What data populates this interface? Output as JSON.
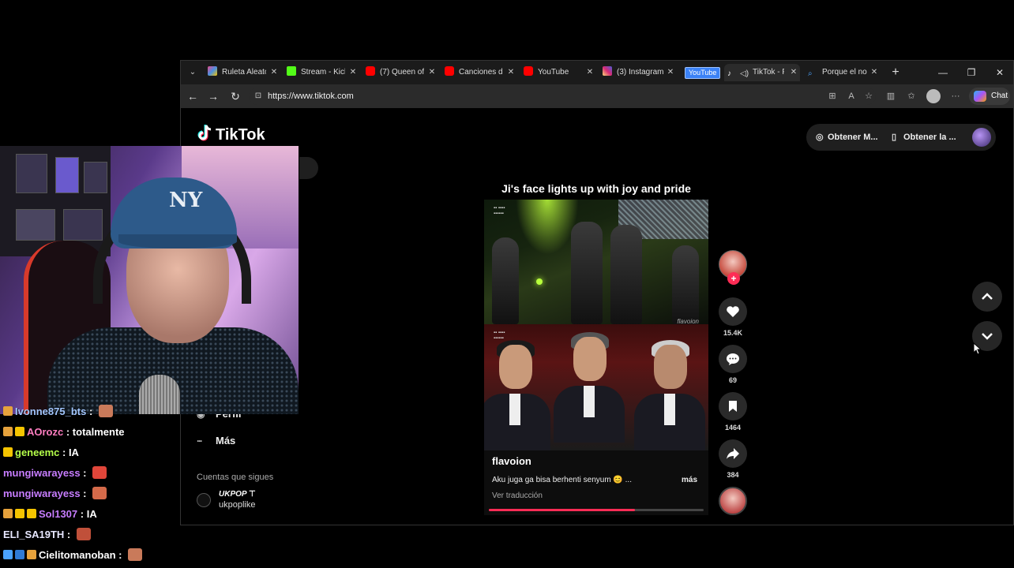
{
  "browser": {
    "tabs": [
      {
        "label": "Ruleta Aleatoria",
        "favicon_color": "#e94b8a"
      },
      {
        "label": "Stream - Kick",
        "favicon_color": "#53fc18"
      },
      {
        "label": "(7) Queen of",
        "favicon_color": "#ff0000"
      },
      {
        "label": "Canciones de",
        "favicon_color": "#ff0000"
      },
      {
        "label": "YouTube",
        "favicon_color": "#ff0000"
      },
      {
        "label": "(3) Instagram",
        "favicon_color": "#d62976"
      },
      {
        "label": "TikTok - F",
        "favicon_color": "#ffffff"
      },
      {
        "label": "Porque el no",
        "favicon_color": "#4aa3ff"
      }
    ],
    "youtube_badge": "YouTube",
    "url": "https://www.tiktok.com",
    "chat_label": "Chat"
  },
  "tiktok": {
    "logo": "TikTok",
    "top_buttons": [
      "Obtener M...",
      "Obtener la ..."
    ],
    "nav": [
      {
        "label": "Perfil",
        "icon": "user-icon"
      },
      {
        "label": "Más",
        "icon": "more-icon"
      }
    ],
    "following_title": "Cuentas que sigues",
    "following": [
      {
        "name": "UKPOP",
        "username": "ukpoplike"
      }
    ],
    "video": {
      "caption_overlay": "Ji's face lights up with joy and pride",
      "author": "flavoion",
      "description": "Aku juga ga bisa berhenti senyum 😊 ...",
      "more": "más",
      "translate": "Ver traducción",
      "watermark": "flavoion",
      "progress": 0.68
    },
    "actions": {
      "likes": "15.4K",
      "comments": "69",
      "saves": "1464",
      "shares": "384"
    }
  },
  "chat": [
    {
      "user": "Ivonne875_bts",
      "color": "#a3c7ff",
      "msg": "",
      "emote": "#c97a5a",
      "badges": [
        "#e6a23c"
      ]
    },
    {
      "user": "AOrozc",
      "color": "#ff7ec1",
      "msg": "totalmente",
      "emote": "",
      "badges": [
        "#e6a23c",
        "#f5c400"
      ]
    },
    {
      "user": "geneemc",
      "color": "#b5ff4a",
      "msg": "IA",
      "emote": "",
      "badges": [
        "#f5c400"
      ]
    },
    {
      "user": "mungiwarayess",
      "color": "#c77dff",
      "msg": "",
      "emote": "#e0463a",
      "badges": []
    },
    {
      "user": "mungiwarayess",
      "color": "#c77dff",
      "msg": "",
      "emote": "#d46a4a",
      "badges": []
    },
    {
      "user": "Sol1307",
      "color": "#c77dff",
      "msg": "IA",
      "emote": "",
      "badges": [
        "#e6a23c",
        "#f5c400",
        "#f5c400"
      ]
    },
    {
      "user": "ELI_SA19TH",
      "color": "#e8e8ff",
      "msg": "",
      "emote": "#c0503a",
      "badges": []
    },
    {
      "user": "Cielitomanoban",
      "color": "#ffffff",
      "msg": "",
      "emote": "#c97a5a",
      "badges": [
        "#4aa3ff",
        "#2f7bd6",
        "#e6a23c"
      ]
    }
  ],
  "colors": {
    "tiktok_accent": "#fe2c55",
    "page_bg": "#000000"
  }
}
